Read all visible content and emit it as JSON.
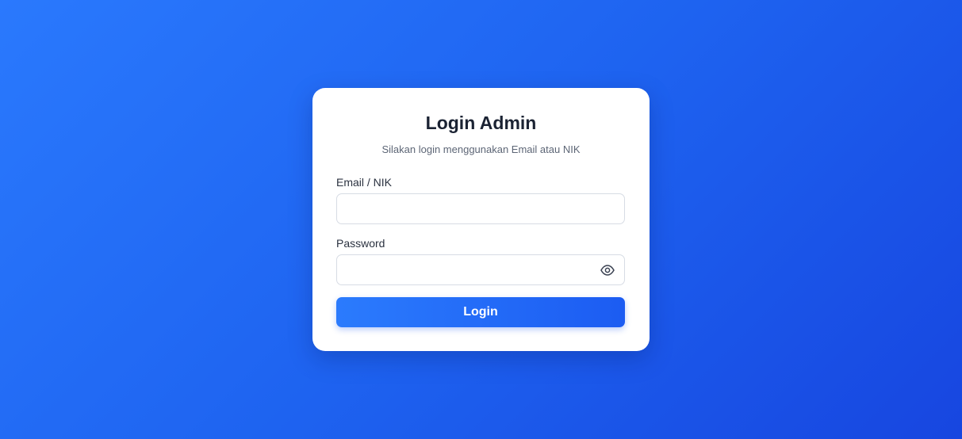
{
  "login": {
    "title": "Login Admin",
    "subtitle": "Silakan login menggunakan Email atau NIK",
    "email_label": "Email / NIK",
    "email_value": "",
    "password_label": "Password",
    "password_value": "",
    "toggle_icon": "eye-icon",
    "button_label": "Login"
  },
  "colors": {
    "background_start": "#2a79fd",
    "background_end": "#1746e0",
    "button": "#1c5cf2",
    "card": "#ffffff"
  }
}
